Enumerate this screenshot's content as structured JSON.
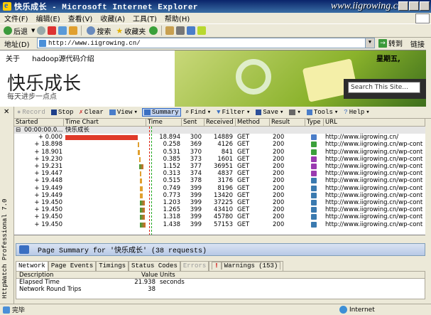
{
  "window": {
    "title": "快乐成长 - Microsoft Internet Explorer",
    "watermark": "www.iigrowing.cn"
  },
  "menu": [
    "文件(F)",
    "编辑(E)",
    "查看(V)",
    "收藏(A)",
    "工具(T)",
    "帮助(H)"
  ],
  "toolbar": {
    "back": "后退",
    "search": "搜索",
    "favorites": "收藏夹"
  },
  "address": {
    "label": "地址(D)",
    "url": "http://www.iigrowing.cn/",
    "go": "转到",
    "links": "链接"
  },
  "webpage": {
    "nav": [
      "关于",
      "hadoop源代码介绍"
    ],
    "date": "星期五,",
    "title": "快乐成长",
    "subtitle": "每天进步一点点",
    "search_placeholder": "Search This Site..."
  },
  "httpwatch": {
    "side_title": "HttpWatch Professional 7.0",
    "toolbar": [
      "Record",
      "Stop",
      "Clear",
      "View",
      "Summary",
      "Find",
      "Filter",
      "Save",
      "Tools",
      "Help"
    ],
    "columns": [
      "Started",
      "Time Chart",
      "Time",
      "Sent",
      "Received",
      "Method",
      "Result",
      "Type",
      "URL"
    ],
    "top_row": {
      "started": "00:00:00.0...",
      "chart": "快乐成长"
    },
    "rows": [
      {
        "started": "+ 0.000",
        "time": "18.894",
        "sent": "300",
        "received": "14889",
        "method": "GET",
        "result": "200",
        "url": "http://www.iigrowing.cn/",
        "type_color": "#4a7dc9"
      },
      {
        "started": "+ 18.898",
        "time": "0.258",
        "sent": "369",
        "received": "4126",
        "method": "GET",
        "result": "200",
        "url": "http://www.iigrowing.cn/wp-cont",
        "type_color": "#3aa03a"
      },
      {
        "started": "+ 18.901",
        "time": "0.531",
        "sent": "370",
        "received": "841",
        "method": "GET",
        "result": "200",
        "url": "http://www.iigrowing.cn/wp-cont",
        "type_color": "#3aa03a"
      },
      {
        "started": "+ 19.230",
        "time": "0.385",
        "sent": "373",
        "received": "1601",
        "method": "GET",
        "result": "200",
        "url": "http://www.iigrowing.cn/wp-cont",
        "type_color": "#9a3ab0"
      },
      {
        "started": "+ 19.231",
        "time": "1.152",
        "sent": "377",
        "received": "36951",
        "method": "GET",
        "result": "200",
        "url": "http://www.iigrowing.cn/wp-cont",
        "type_color": "#9a3ab0"
      },
      {
        "started": "+ 19.447",
        "time": "0.313",
        "sent": "374",
        "received": "4837",
        "method": "GET",
        "result": "200",
        "url": "http://www.iigrowing.cn/wp-cont",
        "type_color": "#9a3ab0"
      },
      {
        "started": "+ 19.448",
        "time": "0.515",
        "sent": "378",
        "received": "3176",
        "method": "GET",
        "result": "200",
        "url": "http://www.iigrowing.cn/wp-cont",
        "type_color": "#3a7ab0"
      },
      {
        "started": "+ 19.449",
        "time": "0.749",
        "sent": "399",
        "received": "8196",
        "method": "GET",
        "result": "200",
        "url": "http://www.iigrowing.cn/wp-cont",
        "type_color": "#3a7ab0"
      },
      {
        "started": "+ 19.449",
        "time": "0.773",
        "sent": "399",
        "received": "13420",
        "method": "GET",
        "result": "200",
        "url": "http://www.iigrowing.cn/wp-cont",
        "type_color": "#3a7ab0"
      },
      {
        "started": "+ 19.450",
        "time": "1.203",
        "sent": "399",
        "received": "37225",
        "method": "GET",
        "result": "200",
        "url": "http://www.iigrowing.cn/wp-cont",
        "type_color": "#3a7ab0"
      },
      {
        "started": "+ 19.450",
        "time": "1.265",
        "sent": "399",
        "received": "43410",
        "method": "GET",
        "result": "200",
        "url": "http://www.iigrowing.cn/wp-cont",
        "type_color": "#3a7ab0"
      },
      {
        "started": "+ 19.450",
        "time": "1.318",
        "sent": "399",
        "received": "45780",
        "method": "GET",
        "result": "200",
        "url": "http://www.iigrowing.cn/wp-cont",
        "type_color": "#3a7ab0"
      },
      {
        "started": "+ 19.450",
        "time": "1.438",
        "sent": "399",
        "received": "57153",
        "method": "GET",
        "result": "200",
        "url": "http://www.iigrowing.cn/wp-cont",
        "type_color": "#3a7ab0"
      }
    ],
    "summary_title": "Page Summary for '快乐成长' (38 requests)",
    "tabs": [
      "Network",
      "Page Events",
      "Timings",
      "Status Codes",
      "Errors",
      "Warnings (153)"
    ],
    "summary_columns": [
      "Description",
      "Value",
      "Units"
    ],
    "summary_rows": [
      {
        "desc": "Elapsed Time",
        "value": "21.938",
        "units": "seconds"
      },
      {
        "desc": "Network Round Trips",
        "value": "38",
        "units": ""
      }
    ]
  },
  "status": {
    "left": "完毕",
    "zone": "Internet"
  }
}
